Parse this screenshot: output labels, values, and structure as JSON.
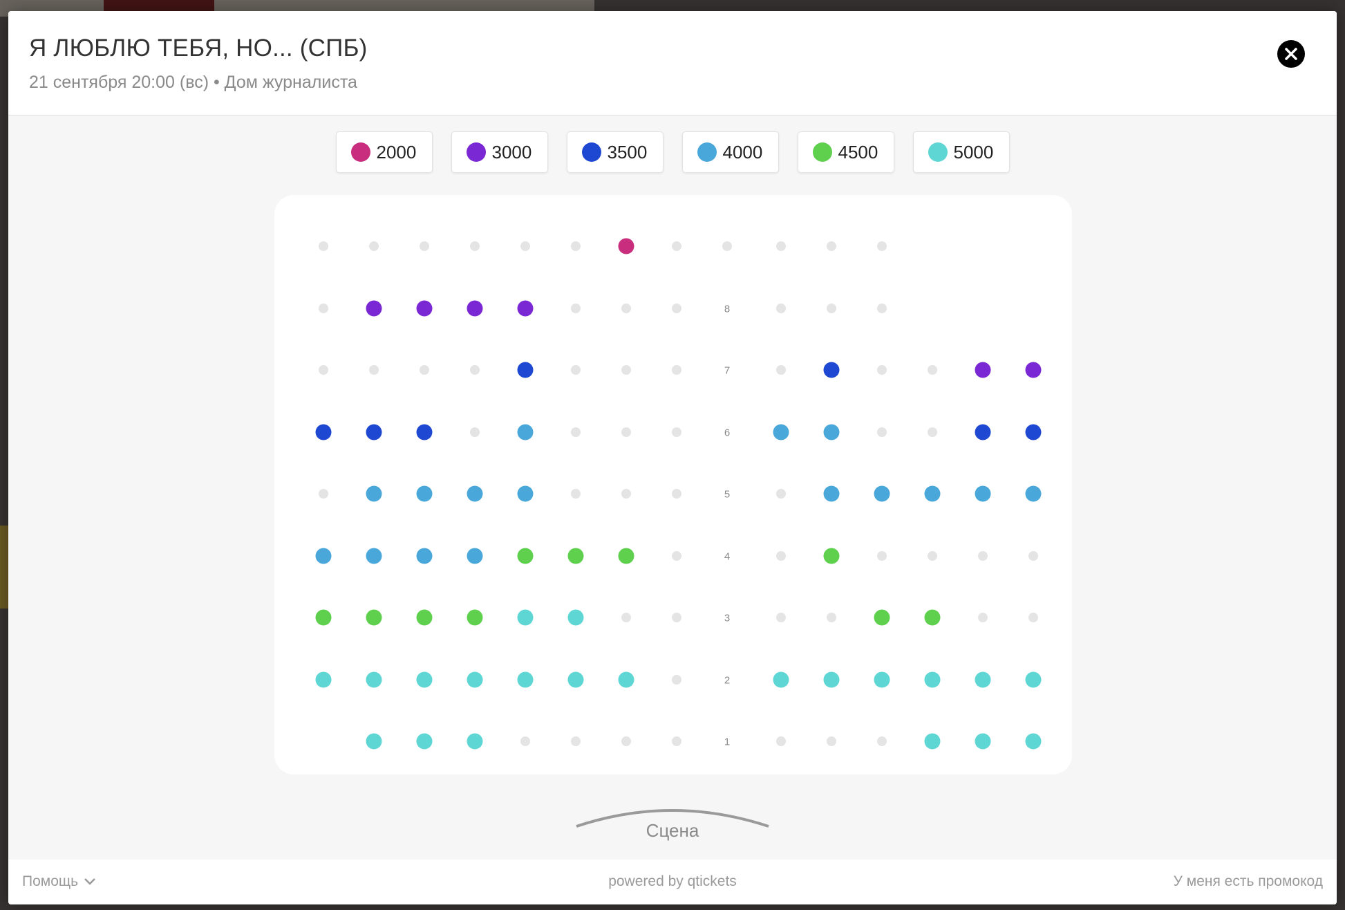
{
  "event": {
    "title": "Я ЛЮБЛЮ ТЕБЯ, НО... (СПБ)",
    "subtitle": "21 сентября 20:00 (вс) • Дом журналиста"
  },
  "legend": [
    {
      "price": "2000",
      "color": "#c92d7e"
    },
    {
      "price": "3000",
      "color": "#7a27d4"
    },
    {
      "price": "3500",
      "color": "#1f48d2"
    },
    {
      "price": "4000",
      "color": "#4aa7d9"
    },
    {
      "price": "4500",
      "color": "#5fd04e"
    },
    {
      "price": "5000",
      "color": "#5ed6d4"
    }
  ],
  "seat_colors": {
    "taken": "#e4e4e4",
    "a": "#c92d7e",
    "b": "#7a27d4",
    "c": "#1f48d2",
    "d": "#4aa7d9",
    "e": "#5fd04e",
    "f": "#5ed6d4"
  },
  "hall_rows": [
    {
      "number": "",
      "seats": "______a_____"
    },
    {
      "number": "8",
      "seats": "_bbbb___ ___"
    },
    {
      "number": "7",
      "seats": "____c___ _c__bb"
    },
    {
      "number": "6",
      "seats": "ccc_d___ dd__cc"
    },
    {
      "number": "5",
      "seats": "_dddd___ _ddddd"
    },
    {
      "number": "4",
      "seats": "ddddeee_ _e____"
    },
    {
      "number": "3",
      "seats": "eeeeff__ __ee__"
    },
    {
      "number": "2",
      "seats": "fffffff_ ffffff"
    },
    {
      "number": "1",
      "seats": ".fff____ ___fff"
    }
  ],
  "stage": {
    "label": "Сцена"
  },
  "footer": {
    "help": "Помощь",
    "powered": "powered by qtickets",
    "promo": "У меня есть промокод"
  },
  "icons": {
    "close": "close-icon",
    "help_chevron": "chevron-down-icon"
  }
}
